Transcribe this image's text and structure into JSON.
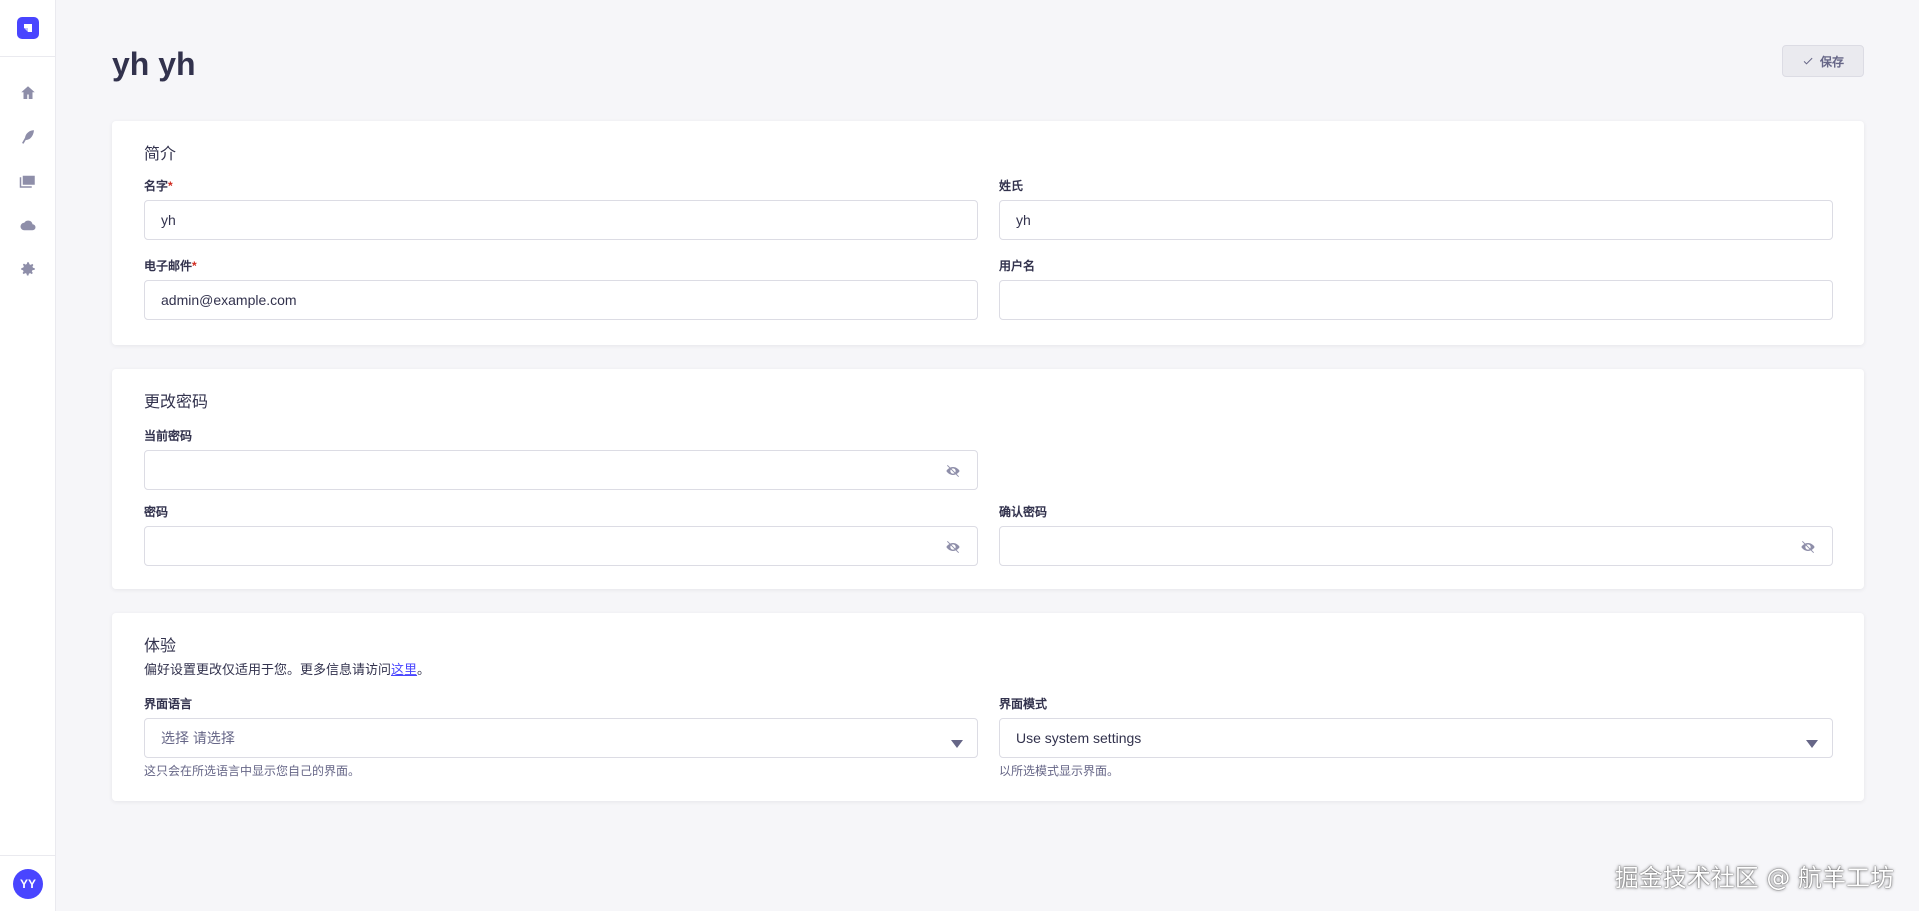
{
  "header": {
    "title": "yh yh",
    "save_label": "保存"
  },
  "sidebar": {
    "items": [
      {
        "name": "home-icon"
      },
      {
        "name": "feather-icon"
      },
      {
        "name": "media-library-icon"
      },
      {
        "name": "cloud-icon"
      },
      {
        "name": "settings-icon"
      }
    ],
    "avatar_initials": "YY"
  },
  "profile": {
    "title": "简介",
    "first_name_label": "名字",
    "first_name_value": "yh",
    "last_name_label": "姓氏",
    "last_name_value": "yh",
    "email_label": "电子邮件",
    "email_value": "admin@example.com",
    "username_label": "用户名",
    "username_value": ""
  },
  "password": {
    "title": "更改密码",
    "current_label": "当前密码",
    "new_label": "密码",
    "confirm_label": "确认密码"
  },
  "experience": {
    "title": "体验",
    "subtitle_prefix": "偏好设置更改仅适用于您。更多信息请访问",
    "subtitle_link": "这里",
    "subtitle_suffix": "。",
    "language_label": "界面语言",
    "language_value": "选择 请选择",
    "language_hint": "这只会在所选语言中显示您自己的界面。",
    "mode_label": "界面模式",
    "mode_value": "Use system settings",
    "mode_hint": "以所选模式显示界面。"
  },
  "required_mark": "*",
  "watermark": "掘金技术社区 @ 航羊工坊",
  "colors": {
    "primary": "#4945ff",
    "background": "#f6f6f9",
    "danger": "#d02b20"
  }
}
